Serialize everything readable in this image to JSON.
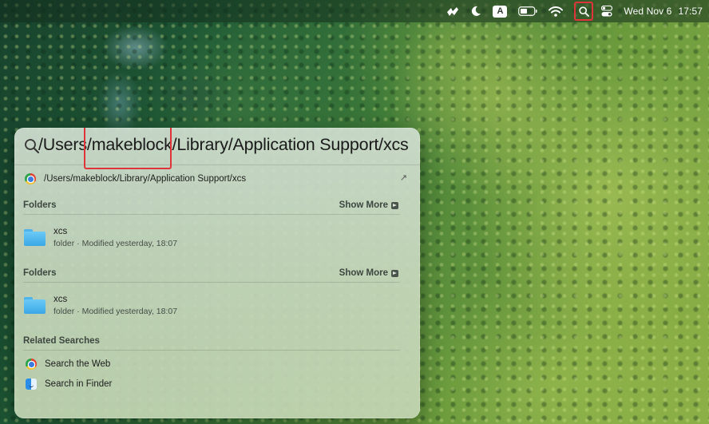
{
  "menubar": {
    "icons": [
      "rocket-icon",
      "moon-icon",
      "input-source-icon",
      "battery-icon",
      "wifi-icon",
      "spotlight-icon",
      "control-center-icon"
    ],
    "input_source_label": "A",
    "date": "Wed Nov 6",
    "time": "17:57"
  },
  "spotlight": {
    "query": "/Users/makeblock/Library/Application Support/xcs",
    "top_hit": {
      "label": "/Users/makeblock/Library/Application Support/xcs",
      "icon": "chrome-icon"
    },
    "sections": [
      {
        "title": "Folders",
        "show_more": "Show More",
        "results": [
          {
            "name": "xcs",
            "subtitle": "folder · Modified yesterday, 18:07",
            "icon": "folder-icon"
          }
        ]
      },
      {
        "title": "Folders",
        "show_more": "Show More",
        "results": [
          {
            "name": "xcs",
            "subtitle": "folder · Modified yesterday, 18:07",
            "icon": "folder-icon"
          }
        ]
      }
    ],
    "related": {
      "title": "Related Searches",
      "items": [
        {
          "label": "Search the Web",
          "icon": "chrome-icon"
        },
        {
          "label": "Search in Finder",
          "icon": "finder-icon"
        }
      ]
    }
  },
  "colors": {
    "highlight_box": "#e0343b",
    "folder_blue": "#3aa7e6"
  }
}
